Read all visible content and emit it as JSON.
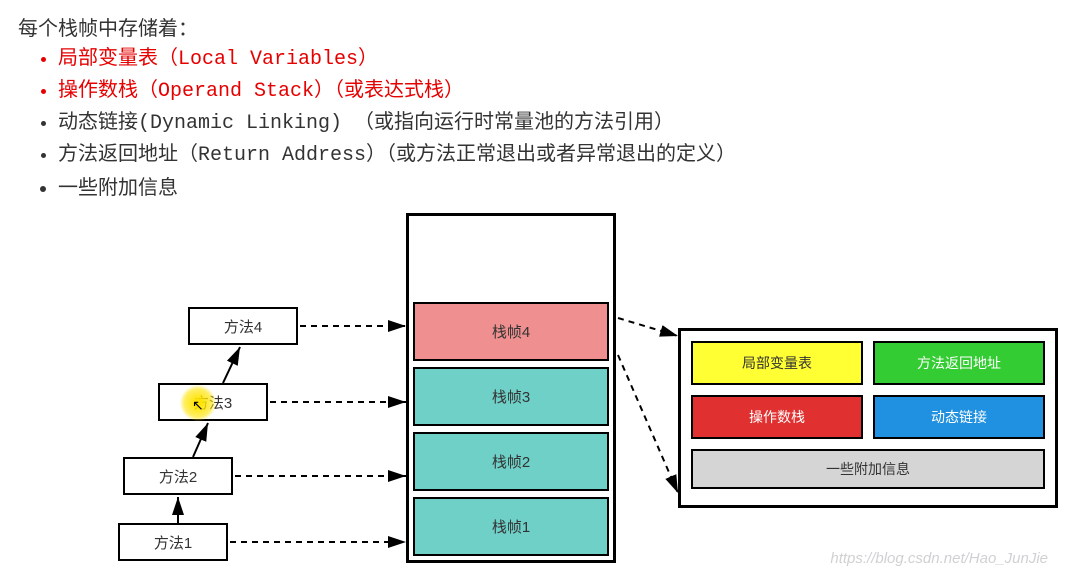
{
  "header": "每个栈帧中存储着：",
  "bullets": [
    {
      "text": "局部变量表（Local Variables）",
      "red": true
    },
    {
      "text": "操作数栈（Operand Stack）（或表达式栈）",
      "red": true
    },
    {
      "text": "动态链接(Dynamic Linking) （或指向运行时常量池的方法引用）",
      "red": false
    },
    {
      "text": "方法返回地址（Return Address）（或方法正常退出或者异常退出的定义）",
      "red": false
    },
    {
      "text": "一些附加信息",
      "red": false
    }
  ],
  "methods": {
    "m4": "方法4",
    "m3": "方法3",
    "m2": "方法2",
    "m1": "方法1"
  },
  "frames": {
    "f4": "栈帧4",
    "f3": "栈帧3",
    "f2": "栈帧2",
    "f1": "栈帧1"
  },
  "detail": {
    "local_vars": "局部变量表",
    "return_addr": "方法返回地址",
    "operand": "操作数栈",
    "dyn_link": "动态链接",
    "extra": "一些附加信息"
  },
  "watermark": "https://blog.csdn.net/Hao_JunJie"
}
